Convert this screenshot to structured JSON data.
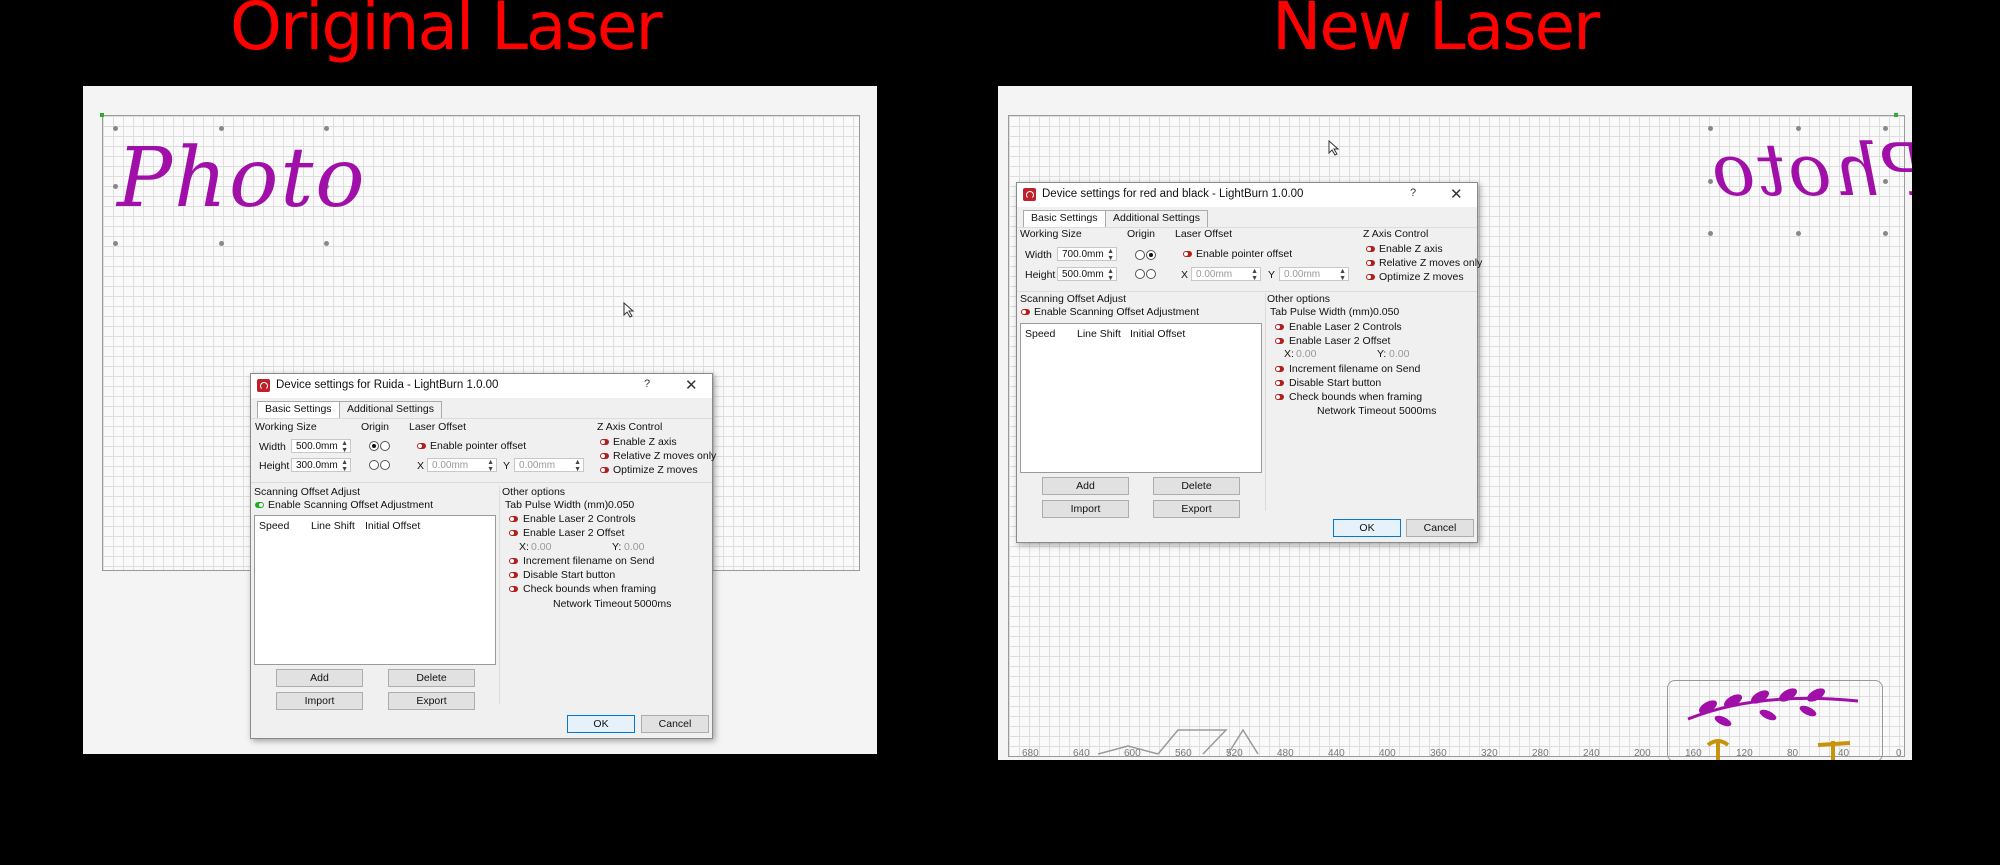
{
  "headings": {
    "left": "Original Laser",
    "right": "New Laser"
  },
  "left": {
    "canvas_text": "Photo",
    "dialog": {
      "title": "Device settings for Ruida - LightBurn 1.0.00",
      "help": "?",
      "close": "✕",
      "tabs": [
        "Basic Settings",
        "Additional Settings"
      ],
      "working_size_label": "Working Size",
      "width_label": "Width",
      "width_value": "500.0mm",
      "height_label": "Height",
      "height_value": "300.0mm",
      "origin_label": "Origin",
      "laser_offset_label": "Laser Offset",
      "pointer_offset_label": "Enable pointer offset",
      "x_label": "X",
      "x_value": "0.00mm",
      "y_label": "Y",
      "y_value": "0.00mm",
      "z_axis_label": "Z Axis Control",
      "z_options": [
        "Enable Z axis",
        "Relative Z moves only",
        "Optimize Z moves"
      ],
      "scanning_label": "Scanning Offset Adjust",
      "scanning_enable": "Enable Scanning Offset Adjustment",
      "columns": [
        "Speed",
        "Line Shift",
        "Initial Offset"
      ],
      "other_label": "Other options",
      "tab_pulse_label": "Tab Pulse Width (mm)",
      "tab_pulse_value": "0.050",
      "laser2_controls": "Enable Laser 2 Controls",
      "laser2_offset": "Enable Laser 2 Offset",
      "x2_label": "X:",
      "x2_value": "0.00",
      "y2_label": "Y:",
      "y2_value": "0.00",
      "options": [
        "Increment filename on Send",
        "Disable Start button",
        "Check bounds when framing"
      ],
      "timeout_label": "Network Timeout",
      "timeout_value": "5000ms",
      "add": "Add",
      "delete": "Delete",
      "import": "Import",
      "export": "Export",
      "ok": "OK",
      "cancel": "Cancel"
    }
  },
  "right": {
    "canvas_text": "Photo",
    "ruler": [
      "680",
      "640",
      "600",
      "560",
      "520",
      "480",
      "440",
      "400",
      "360",
      "320",
      "280",
      "240",
      "200",
      "160",
      "120",
      "80",
      "40",
      "0"
    ],
    "dialog": {
      "title": "Device settings for red and black - LightBurn 1.0.00",
      "help": "?",
      "close": "✕",
      "tabs": [
        "Basic Settings",
        "Additional Settings"
      ],
      "working_size_label": "Working Size",
      "width_label": "Width",
      "width_value": "700.0mm",
      "height_label": "Height",
      "height_value": "500.0mm",
      "origin_label": "Origin",
      "laser_offset_label": "Laser Offset",
      "pointer_offset_label": "Enable pointer offset",
      "x_label": "X",
      "x_value": "0.00mm",
      "y_label": "Y",
      "y_value": "0.00mm",
      "z_axis_label": "Z Axis Control",
      "z_options": [
        "Enable Z axis",
        "Relative Z moves only",
        "Optimize Z moves"
      ],
      "scanning_label": "Scanning Offset Adjust",
      "scanning_enable": "Enable Scanning Offset Adjustment",
      "columns": [
        "Speed",
        "Line Shift",
        "Initial Offset"
      ],
      "other_label": "Other options",
      "tab_pulse_label": "Tab Pulse Width (mm)",
      "tab_pulse_value": "0.050",
      "laser2_controls": "Enable Laser 2 Controls",
      "laser2_offset": "Enable Laser 2 Offset",
      "x2_label": "X:",
      "x2_value": "0.00",
      "y2_label": "Y:",
      "y2_value": "0.00",
      "options": [
        "Increment filename on Send",
        "Disable Start button",
        "Check bounds when framing"
      ],
      "timeout_label": "Network Timeout",
      "timeout_value": "5000ms",
      "add": "Add",
      "delete": "Delete",
      "import": "Import",
      "export": "Export",
      "ok": "OK",
      "cancel": "Cancel"
    }
  },
  "colors": {
    "heading": "#ff0000",
    "script_text": "#a010a8",
    "toggle_on": "#22aa22",
    "toggle_off": "#b02020"
  }
}
